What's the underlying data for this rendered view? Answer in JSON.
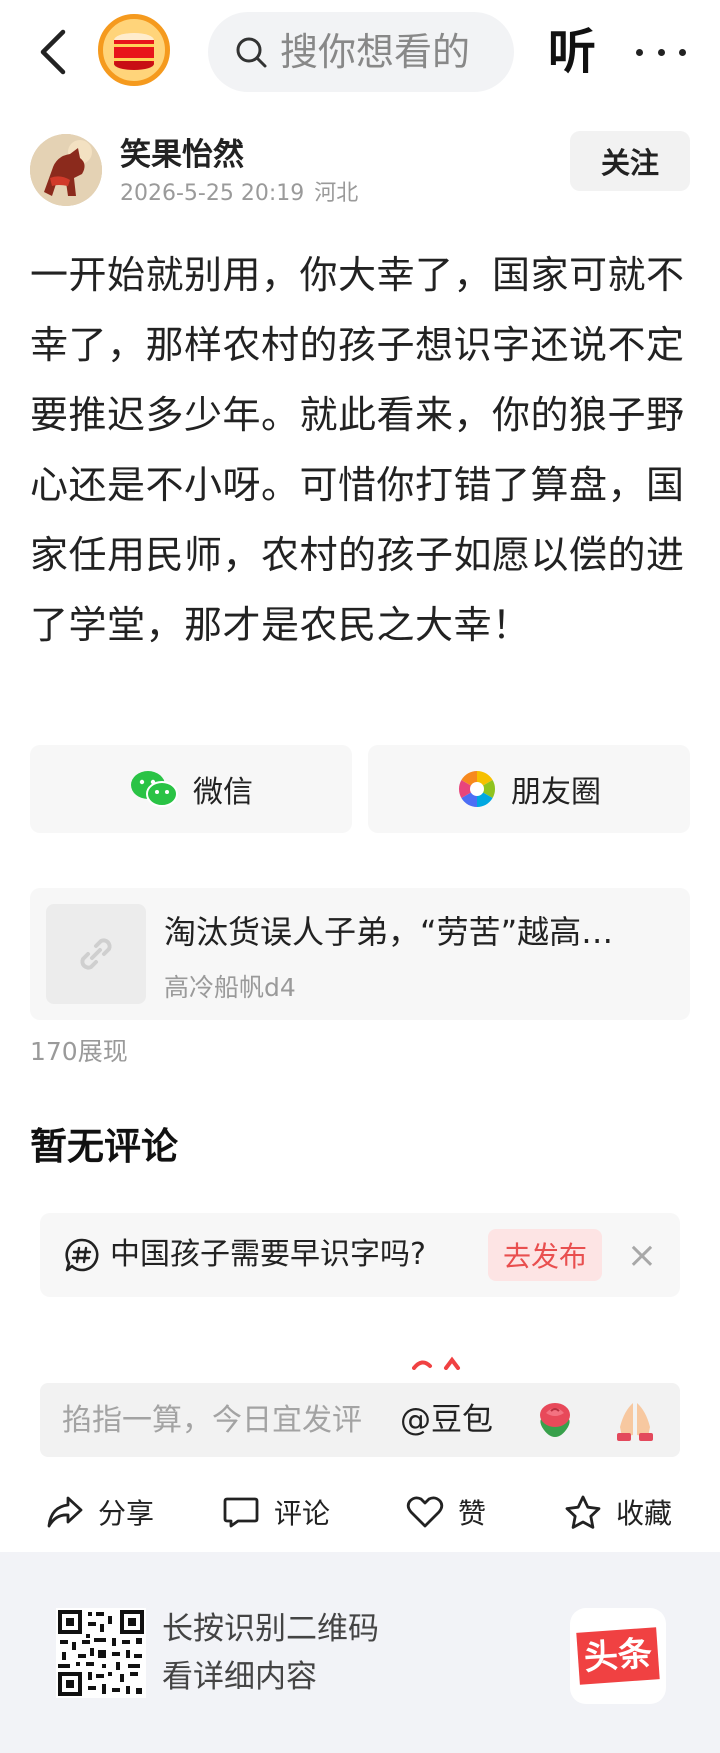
{
  "colors": {
    "accent_red": "#f04142",
    "publish_bg": "#fde4e4",
    "publish_text": "#e94f4f",
    "muted": "#9a9a9a",
    "card_bg": "#f7f7f7",
    "footer_bg": "#f2f3f7"
  },
  "topbar": {
    "back_icon": "chevron-left-icon",
    "search_placeholder": "搜你想看的",
    "listen_label": "听",
    "more_icon": "more-dots-icon"
  },
  "author": {
    "name": "笑果怡然",
    "date": "2026-5-25 20:19",
    "location": "河北",
    "follow_label": "关注"
  },
  "post": {
    "body": "一开始就别用，你大幸了，国家可就不幸了，那样农村的孩子想识字还说不定要推迟多少年。就此看来，你的狼子野心还是不小呀。可惜你打错了算盘，国家任用民师，农村的孩子如愿以偿的进了学堂，那才是农民之大幸！"
  },
  "share": {
    "wechat_label": "微信",
    "moments_label": "朋友圈"
  },
  "linked_article": {
    "title": "淘汰货误人子弟，“劳苦”越高…",
    "source": "高冷船帆d4"
  },
  "stats": {
    "views": "170展现"
  },
  "comments": {
    "empty_label": "暂无评论"
  },
  "topic": {
    "text": "中国孩子需要早识字吗?",
    "publish_label": "去发布",
    "close_label": "×"
  },
  "comment_bar": {
    "placeholder": "掐指一算，今日宜发评",
    "mention": "@豆包"
  },
  "actions": {
    "share": "分享",
    "comment": "评论",
    "like": "赞",
    "favorite": "收藏"
  },
  "footer": {
    "line1": "长按识别二维码",
    "line2": "看详细内容",
    "logo_text": "头条"
  }
}
